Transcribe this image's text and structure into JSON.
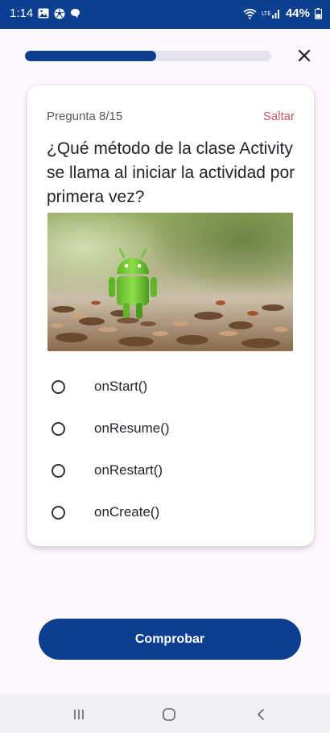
{
  "status_bar": {
    "time": "1:14",
    "battery": "44%",
    "left_icons": [
      "gallery-icon",
      "soccer-ball-icon",
      "chat-icon"
    ],
    "right_icons": [
      "wifi-icon",
      "lte-signal-icon",
      "battery-icon"
    ]
  },
  "progress": {
    "current": 8,
    "total": 15,
    "fraction": 0.533
  },
  "question": {
    "counter": "Pregunta 8/15",
    "skip_label": "Saltar",
    "text": "¿Qué método de la clase Activity se llama al iniciar la actividad por primera vez?"
  },
  "options": [
    {
      "label": "onStart()",
      "selected": false
    },
    {
      "label": "onResume()",
      "selected": false
    },
    {
      "label": "onRestart()",
      "selected": false
    },
    {
      "label": "onCreate()",
      "selected": false
    }
  ],
  "check_button": {
    "label": "Comprobar"
  },
  "colors": {
    "primary": "#0d3f91",
    "skip": "#c65a66",
    "track": "#e3e1ec",
    "background": "#fcf8fd"
  }
}
